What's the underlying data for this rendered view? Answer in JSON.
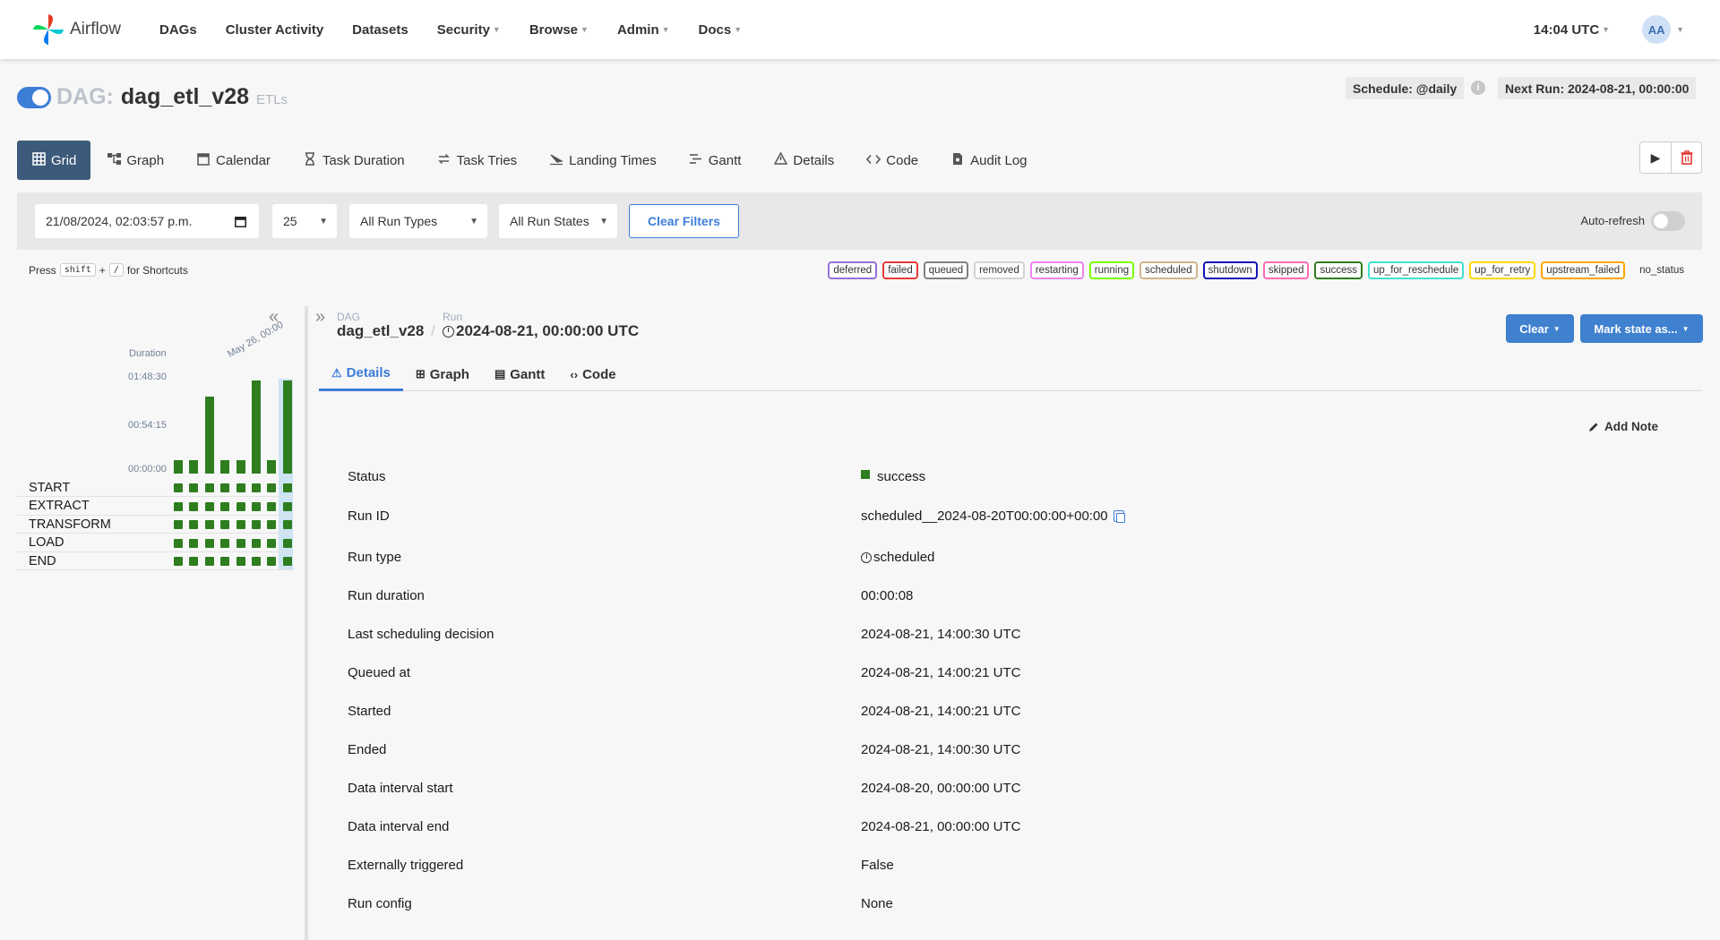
{
  "app": {
    "name": "Airflow"
  },
  "nav": {
    "items": [
      {
        "label": "DAGs",
        "dropdown": false
      },
      {
        "label": "Cluster Activity",
        "dropdown": false
      },
      {
        "label": "Datasets",
        "dropdown": false
      },
      {
        "label": "Security",
        "dropdown": true
      },
      {
        "label": "Browse",
        "dropdown": true
      },
      {
        "label": "Admin",
        "dropdown": true
      },
      {
        "label": "Docs",
        "dropdown": true
      }
    ],
    "clock": "14:04 UTC",
    "avatar": "AA"
  },
  "dag": {
    "prefix": "DAG:",
    "name": "dag_etl_v28",
    "tag": "ETLs",
    "schedule": "Schedule: @daily",
    "next_run": "Next Run: 2024-08-21, 00:00:00"
  },
  "view_tabs": [
    {
      "label": "Grid",
      "icon": "grid-icon",
      "active": true
    },
    {
      "label": "Graph",
      "icon": "graph-icon"
    },
    {
      "label": "Calendar",
      "icon": "calendar-icon"
    },
    {
      "label": "Task Duration",
      "icon": "hourglass-icon"
    },
    {
      "label": "Task Tries",
      "icon": "retry-icon"
    },
    {
      "label": "Landing Times",
      "icon": "landing-icon"
    },
    {
      "label": "Gantt",
      "icon": "gantt-icon"
    },
    {
      "label": "Details",
      "icon": "warning-icon"
    },
    {
      "label": "Code",
      "icon": "code-icon"
    },
    {
      "label": "Audit Log",
      "icon": "file-icon"
    }
  ],
  "filters": {
    "datetime": "21/08/2024, 02:03:57 p.m.",
    "num_runs": "25",
    "run_type": "All Run Types",
    "run_state": "All Run States",
    "clear_label": "Clear Filters",
    "autorefresh_label": "Auto-refresh"
  },
  "shortcuts": {
    "press": "Press",
    "key1": "shift",
    "plus": "+",
    "key2": "/",
    "suffix": "for Shortcuts"
  },
  "legend": [
    {
      "label": "deferred",
      "color": "#9370db"
    },
    {
      "label": "failed",
      "color": "#e53935"
    },
    {
      "label": "queued",
      "color": "#808080"
    },
    {
      "label": "removed",
      "color": "#d3d3d3"
    },
    {
      "label": "restarting",
      "color": "#ee82ee"
    },
    {
      "label": "running",
      "color": "#7cfc00"
    },
    {
      "label": "scheduled",
      "color": "#d2b48c"
    },
    {
      "label": "shutdown",
      "color": "#1414b8"
    },
    {
      "label": "skipped",
      "color": "#ff69b4"
    },
    {
      "label": "success",
      "color": "#2e7d1f"
    },
    {
      "label": "up_for_reschedule",
      "color": "#40e0d0"
    },
    {
      "label": "up_for_retry",
      "color": "#ffd700"
    },
    {
      "label": "upstream_failed",
      "color": "#ffa500"
    },
    {
      "label": "no_status",
      "color": ""
    }
  ],
  "grid": {
    "duration_label": "Duration",
    "date_label": "May 26, 00:00",
    "ticks": [
      "01:48:30",
      "00:54:15",
      "00:00:00"
    ],
    "run_durations": [
      900,
      900,
      5300,
      900,
      900,
      6400,
      900,
      6400
    ],
    "max_duration": 6510,
    "tasks": [
      "START",
      "EXTRACT",
      "TRANSFORM",
      "LOAD",
      "END"
    ],
    "runs_per_task": 8
  },
  "details": {
    "crumb_dag_label": "DAG",
    "crumb_dag": "dag_etl_v28",
    "crumb_run_label": "Run",
    "crumb_run": "2024-08-21, 00:00:00 UTC",
    "clear_button": "Clear",
    "mark_state_button": "Mark state as...",
    "sub_tabs": [
      {
        "label": "Details",
        "active": true
      },
      {
        "label": "Graph"
      },
      {
        "label": "Gantt"
      },
      {
        "label": "Code"
      }
    ],
    "add_note": "Add Note",
    "rows": [
      {
        "label": "Status",
        "value": "success"
      },
      {
        "label": "Run ID",
        "value": "scheduled__2024-08-20T00:00:00+00:00"
      },
      {
        "label": "Run type",
        "value": "scheduled"
      },
      {
        "label": "Run duration",
        "value": "00:00:08"
      },
      {
        "label": "Last scheduling decision",
        "value": "2024-08-21, 14:00:30 UTC"
      },
      {
        "label": "Queued at",
        "value": "2024-08-21, 14:00:21 UTC"
      },
      {
        "label": "Started",
        "value": "2024-08-21, 14:00:21 UTC"
      },
      {
        "label": "Ended",
        "value": "2024-08-21, 14:00:30 UTC"
      },
      {
        "label": "Data interval start",
        "value": "2024-08-20, 00:00:00 UTC"
      },
      {
        "label": "Data interval end",
        "value": "2024-08-21, 00:00:00 UTC"
      },
      {
        "label": "Externally triggered",
        "value": "False"
      },
      {
        "label": "Run config",
        "value": "None"
      }
    ]
  },
  "colors": {
    "accent": "#3c7dd8",
    "success": "#2e7d1f",
    "active_tab": "#3c5a7a"
  }
}
